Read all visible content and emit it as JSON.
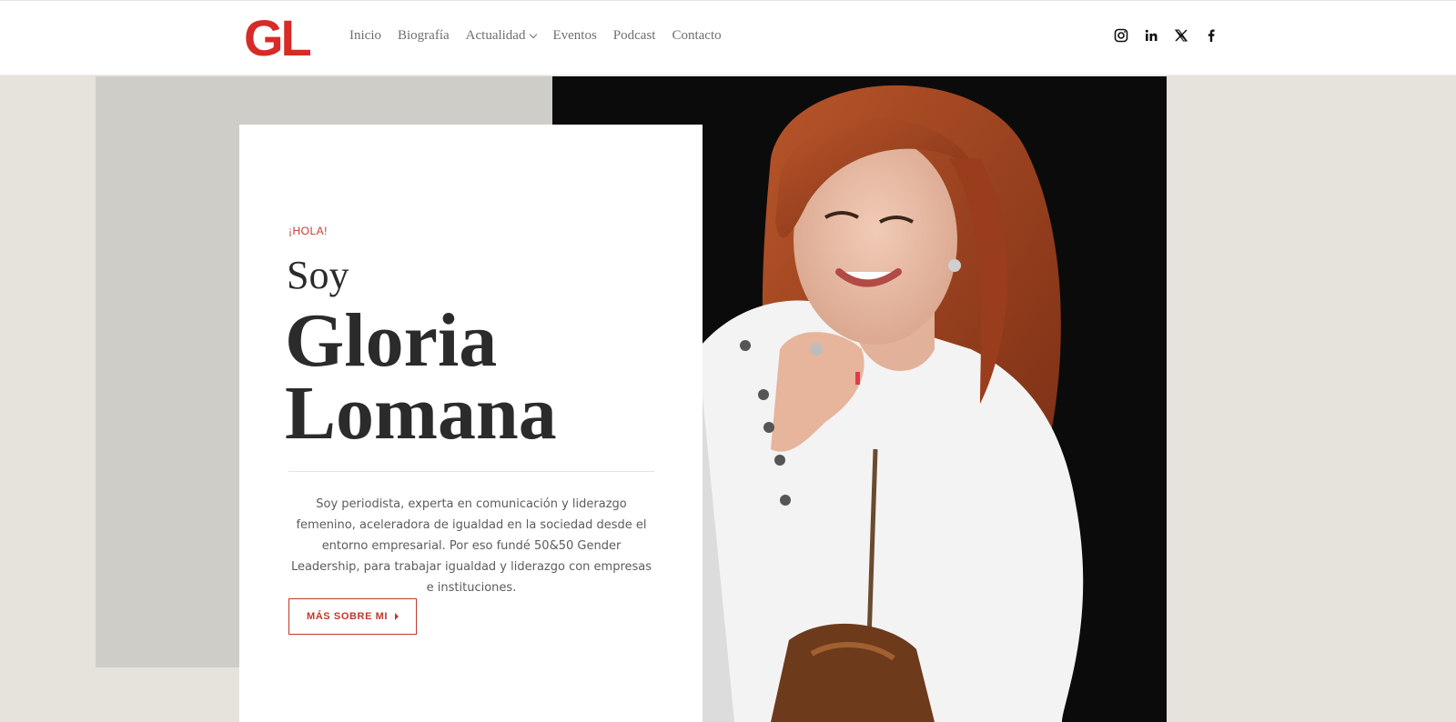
{
  "brand": {
    "logo_text": "GL",
    "accent_color": "#d62b27"
  },
  "nav": {
    "items": [
      {
        "label": "Inicio",
        "has_dropdown": false
      },
      {
        "label": "Biografía",
        "has_dropdown": false
      },
      {
        "label": "Actualidad",
        "has_dropdown": true
      },
      {
        "label": "Eventos",
        "has_dropdown": false
      },
      {
        "label": "Podcast",
        "has_dropdown": false
      },
      {
        "label": "Contacto",
        "has_dropdown": false
      }
    ]
  },
  "social": {
    "icons": [
      "instagram-icon",
      "linkedin-icon",
      "x-icon",
      "facebook-icon"
    ]
  },
  "hero": {
    "eyebrow": "¡HOLA!",
    "intro": "Soy",
    "name_line1": "Gloria",
    "name_line2": "Lomana",
    "bio": "Soy periodista, experta en comunicación y liderazgo femenino, aceleradora de igualdad en la sociedad desde el entorno empresarial. Por eso fundé 50&50 Gender Leadership, para trabajar igualdad y liderazgo con empresas e instituciones.",
    "cta_label": "MÁS SOBRE MI",
    "photo_subject": "portrait of smiling woman with auburn hair in white jacket"
  }
}
